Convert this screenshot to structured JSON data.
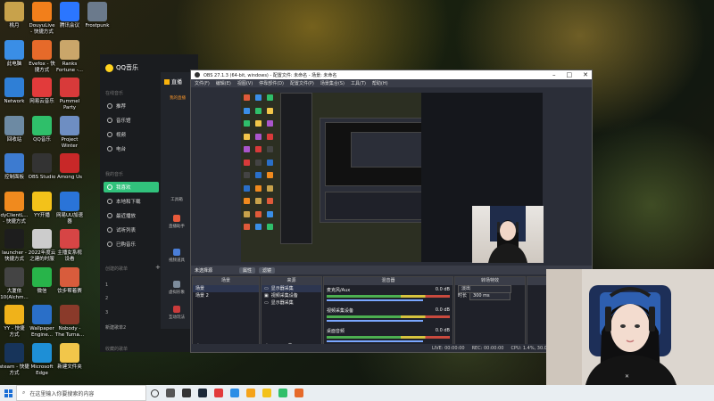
{
  "desktop": {
    "icons": [
      {
        "label": "桃月",
        "color": "#c8a24b",
        "col": 0,
        "row": 0
      },
      {
        "label": "DouyuLive\n- 快捷方式",
        "color": "#f27f1b",
        "col": 1,
        "row": 0
      },
      {
        "label": "腾讯会议",
        "color": "#2b76ff",
        "col": 2,
        "row": 0
      },
      {
        "label": "Frostpunk",
        "color": "#6b7a8c",
        "col": 3,
        "row": 0
      },
      {
        "label": "此电脑",
        "color": "#3a8ee6",
        "col": 0,
        "row": 1
      },
      {
        "label": "Evefox - 快\n捷方式",
        "color": "#e66a2a",
        "col": 1,
        "row": 1
      },
      {
        "label": "Ranks\nFortune -...",
        "color": "#caa66a",
        "col": 2,
        "row": 1
      },
      {
        "label": "Network",
        "color": "#2f7fd6",
        "col": 0,
        "row": 2
      },
      {
        "label": "网易云音乐",
        "color": "#e23b3b",
        "col": 1,
        "row": 2
      },
      {
        "label": "Pummel\nParty",
        "color": "#d83a3a",
        "col": 2,
        "row": 2
      },
      {
        "label": "回收站",
        "color": "#6d8aa3",
        "col": 0,
        "row": 3
      },
      {
        "label": "QQ音乐",
        "color": "#2fbf6a",
        "col": 1,
        "row": 3
      },
      {
        "label": "Project\nWinter",
        "color": "#6e8ec2",
        "col": 2,
        "row": 3
      },
      {
        "label": "控制面板",
        "color": "#3d7bd0",
        "col": 0,
        "row": 4
      },
      {
        "label": "OBS Studio",
        "color": "#333333",
        "col": 1,
        "row": 4
      },
      {
        "label": "Among Us",
        "color": "#c82828",
        "col": 2,
        "row": 4
      },
      {
        "label": "dyClientL...\n- 快捷方式",
        "color": "#f08a1e",
        "col": 0,
        "row": 5
      },
      {
        "label": "YY开播",
        "color": "#f3c21a",
        "col": 1,
        "row": 5
      },
      {
        "label": "网易UU加速\n器",
        "color": "#2a74d8",
        "col": 2,
        "row": 5
      },
      {
        "label": "launcher -\n快捷方式",
        "color": "#1d1d1d",
        "col": 0,
        "row": 6
      },
      {
        "label": "2022年度云\n之建的时服",
        "color": "#cccccc",
        "col": 1,
        "row": 6
      },
      {
        "label": "主播女系视\n设看",
        "color": "#d64545",
        "col": 2,
        "row": 6
      },
      {
        "label": "大厦依\n10(Alchm...",
        "color": "#444444",
        "col": 0,
        "row": 7
      },
      {
        "label": "微信",
        "color": "#28b44a",
        "col": 1,
        "row": 7
      },
      {
        "label": "饮步帮着赛",
        "color": "#d85c3c",
        "col": 2,
        "row": 7
      },
      {
        "label": "YY - 快捷\n方式",
        "color": "#f0b21a",
        "col": 0,
        "row": 8
      },
      {
        "label": "Wallpaper\nEngine...",
        "color": "#2a6fc8",
        "col": 1,
        "row": 8
      },
      {
        "label": "Nobody -\nThe Turna...",
        "color": "#8a3a2a",
        "col": 2,
        "row": 8
      },
      {
        "label": "steam - 快捷\n方式",
        "color": "#17345a",
        "col": 0,
        "row": 9
      },
      {
        "label": "Microsoft\nEdge",
        "color": "#1e8fd6",
        "col": 1,
        "row": 9
      },
      {
        "label": "新建文件夹",
        "color": "#f2c64a",
        "col": 2,
        "row": 9
      }
    ]
  },
  "qq_music": {
    "logo": "QQ音乐",
    "section_online": "在线音乐",
    "online_items": [
      "推荐",
      "音乐馆",
      "视频",
      "电台"
    ],
    "section_mine": "我的音乐",
    "mine_items": [
      "我喜欢",
      "本地和下载",
      "最近播放",
      "试听列表",
      "已购音乐"
    ],
    "section_created": "创建的歌单",
    "playlist_nums": [
      "1",
      "2",
      "3"
    ],
    "new_playlist": "新建歌单2",
    "section_collected": "收藏的歌单"
  },
  "huya": {
    "logo": "直播",
    "subtitle": "我的直播",
    "tools_label": "工具箱",
    "tools": [
      "直播助手",
      "视频道具",
      "虚拟形象",
      "互动玩法"
    ]
  },
  "obs": {
    "title": "OBS 27.1.3 (64-bit, windows) - 配置文件: 未命名 - 场景: 未命名",
    "menus": [
      "文件(F)",
      "编辑(E)",
      "视图(V)",
      "停靠部件(D)",
      "配置文件(P)",
      "场景集合(S)",
      "工具(T)",
      "帮助(H)"
    ],
    "no_source": "未选择源",
    "props_btn": "属性",
    "filter_btn": "滤镜",
    "docks": {
      "scenes": {
        "header": "场景",
        "items": [
          "场景",
          "场景 2"
        ]
      },
      "sources": {
        "header": "来源",
        "items": [
          "显示器采集",
          "视频采集设备",
          "显示器采集"
        ]
      },
      "mixer": {
        "header": "混音器",
        "channels": [
          {
            "name": "桌面音频",
            "db": "0.0 dB"
          },
          {
            "name": "视频采集设备",
            "db": "0.0 dB"
          },
          {
            "name": "麦克风/Aux",
            "db": "0.0 dB"
          }
        ]
      },
      "transitions": {
        "header": "转场特效",
        "type": "淡出",
        "duration_label": "时长",
        "duration": "300 ms"
      }
    },
    "status": [
      "LIVE: 00:00:00",
      "REC: 00:00:00",
      "CPU: 1.4%, 30.00 fps"
    ]
  },
  "taskbar": {
    "search_placeholder": "在这里输入你要搜索的内容",
    "apps": [
      {
        "name": "task-view",
        "color": "#555555"
      },
      {
        "name": "obs",
        "color": "#333333"
      },
      {
        "name": "steam",
        "color": "#1b2838"
      },
      {
        "name": "netease",
        "color": "#e23b3b"
      },
      {
        "name": "qq",
        "color": "#2b8ee6"
      },
      {
        "name": "huya",
        "color": "#f5a31a"
      },
      {
        "name": "yy",
        "color": "#f3c21a"
      },
      {
        "name": "qqmusic",
        "color": "#2fbf6a"
      },
      {
        "name": "firefox",
        "color": "#e66a2a"
      }
    ]
  }
}
